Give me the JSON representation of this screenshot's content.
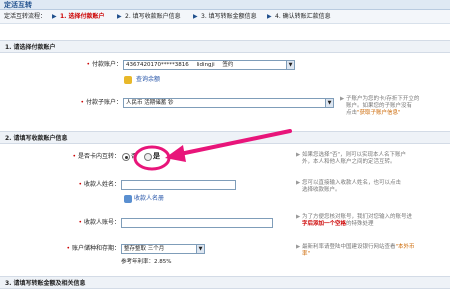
{
  "header": {
    "title": "定活互转"
  },
  "steps": {
    "label": "定活互转流程：",
    "step1": "1. 选择付款账户",
    "step2": "2. 填写收款账户信息",
    "step3": "3. 填写转账金额信息",
    "step4": "4. 确认转账汇款信息"
  },
  "section1": {
    "title": "1. 请选择付款账户",
    "payer_label": "付款账户：",
    "payer_account": "4367420170*****3816",
    "payer_name": "lidingji",
    "payer_status": "签约",
    "balance_link": "查询余额",
    "sub_label": "付款子账户：",
    "sub_value": "人民币 活期储蓄 钞",
    "sub_hint_1": "子账户为您的卡/存折下开立的",
    "sub_hint_2": "账户。如果您的子账户没有",
    "sub_hint_3": "点击",
    "sub_hint_link": "\"获取子账户信息\""
  },
  "section2": {
    "title": "2. 请填写收款账户信息",
    "same_card_label": "是否卡内互转：",
    "option_no": "否",
    "option_yes": "是",
    "same_card_hint_1": "如果您选择\"否\"，则可以实现本人名下账户",
    "same_card_hint_2": "外，本人和他人账户之间的定活互转。",
    "payee_name_label": "收款人姓名：",
    "payee_name_hint_1": "您可以直接输入收款人姓名，也可以点击",
    "payee_name_hint_2": "选择收款账户。",
    "payee_book_link": "收款人名册",
    "payee_acct_label": "收款人账号：",
    "payee_acct_hint_1": "为了方便您核对账号，我们对您输入的账号进",
    "payee_acct_hint_warn": "字后添加一个空格",
    "payee_acct_hint_2": "的特殊处理",
    "type_label": "账户储种和存期：",
    "type_value": "整存整取 三个月",
    "rate_label": "参考年利率：",
    "rate_value": "2.85%",
    "type_hint_1": "最新利率请登陆中国建设银行网站查看",
    "type_hint_link": "\"本外币",
    "type_hint_2": "率\""
  },
  "section3": {
    "title": "3. 请填写转账金额及相关信息"
  },
  "colors": {
    "accent_red": "#cc0000",
    "brand_blue": "#1f4f8c",
    "annotation_pink": "#e8157a"
  }
}
